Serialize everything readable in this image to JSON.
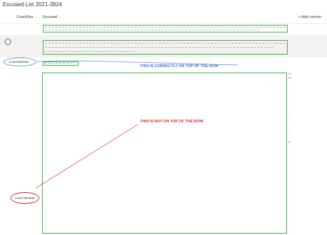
{
  "header": {
    "title": "Excused List 2021-2024",
    "star_icon": "star-icon"
  },
  "columns": {
    "court": "Court/Sec",
    "excused": "Excused",
    "add_column": "+ Add column"
  },
  "rows": [
    {
      "court_member": "",
      "selected": false
    },
    {
      "court_member": "",
      "selected": true
    },
    {
      "court_member": "Court Member"
    }
  ],
  "annotations": {
    "correct": "THIS IS CORRECTLY ON TOP OF THE ROW",
    "incorrect": "THIS IS NOT ON TOP OF THE ROW",
    "bottom_label": "Court Member"
  },
  "edge_marks": [
    "27",
    "27",
    "-",
    "-",
    "-",
    "-",
    "2-",
    "-",
    "-",
    "-",
    "-",
    "-"
  ],
  "colors": {
    "green_box": "#3cb043",
    "blue_annotation": "#2e75d4",
    "red_annotation": "#d42a2a",
    "selected_row": "#f3f2f1"
  }
}
